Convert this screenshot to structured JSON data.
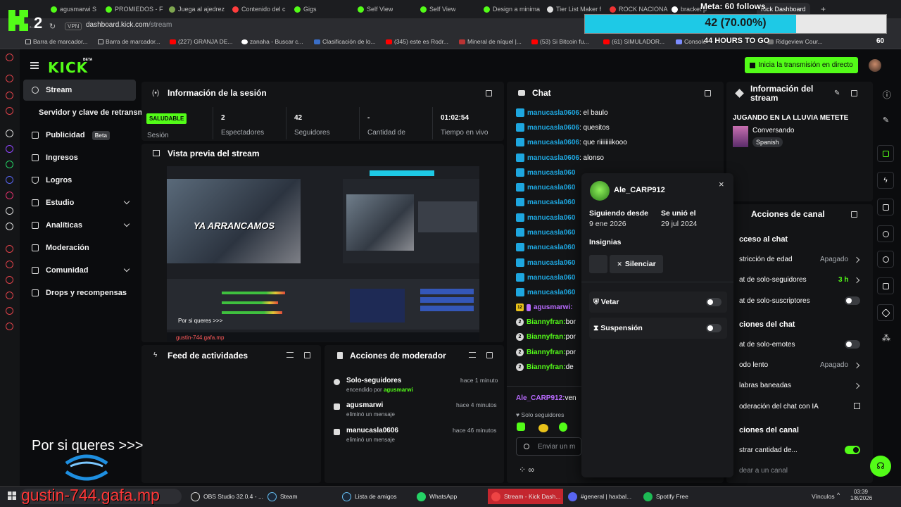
{
  "browser": {
    "tabs": [
      {
        "label": "agusmarwi S"
      },
      {
        "label": "PROMIEDOS - F"
      },
      {
        "label": "Juega al ajedrez"
      },
      {
        "label": "Contenido del c"
      },
      {
        "label": "Gigs"
      },
      {
        "label": "Self View"
      },
      {
        "label": "Self View"
      },
      {
        "label": "Design a minima"
      },
      {
        "label": "Tier List Maker f"
      },
      {
        "label": "ROCK NACIONA"
      },
      {
        "label": "bracket p"
      },
      {
        "label": "Kick Dashboard"
      }
    ],
    "new_tab": "+",
    "vpn": "VPN",
    "url_host": "dashboard.kick.com",
    "url_path": "/stream",
    "bookmarks": [
      "Barra de marcador...",
      "Barra de marcador...",
      "(227) GRANJA DE...",
      "zanaha - Buscar c...",
      "Clasificación de lo...",
      "(345) este es Rodr...",
      "Mineral de níquel |...",
      "(53) Si Bitcoin fu...",
      "(61) SIMULADOR...",
      "Console",
      "Ridgeview Cour..."
    ],
    "bm_count": "60"
  },
  "overlay": {
    "kick_count": "2",
    "meta_title": "Meta: 60 follows",
    "meta_pct_text": "42 (70.00%)",
    "meta_fraction": 0.7,
    "meta_hours": "44 HOURS TO GO",
    "por_si_queres": "Por si queres >>>",
    "gafa_link": "gustin-744.gafa.mp"
  },
  "header": {
    "logo": "KICK",
    "logo_badge": "BETA",
    "go_live": "Inicia la transmisión en directo"
  },
  "sidebar": {
    "items": [
      {
        "label": "Stream"
      },
      {
        "label": "Servidor y clave de retransm"
      },
      {
        "label": "Publicidad",
        "badge": "Beta"
      },
      {
        "label": "Ingresos"
      },
      {
        "label": "Logros"
      },
      {
        "label": "Estudio"
      },
      {
        "label": "Analíticas"
      },
      {
        "label": "Moderación"
      },
      {
        "label": "Comunidad"
      },
      {
        "label": "Drops y recompensas"
      }
    ]
  },
  "session": {
    "title": "Información de la sesión",
    "status": "SALUDABLE",
    "status_label": "Sesión",
    "stats": [
      {
        "value": "2",
        "label": "Espectadores"
      },
      {
        "value": "42",
        "label": "Seguidores"
      },
      {
        "value": "-",
        "label": "Cantidad de"
      },
      {
        "value": "01:02:54",
        "label": "Tiempo en vivo"
      }
    ]
  },
  "preview": {
    "title": "Vista previa del stream",
    "overlay_text": "YA ARRANCAMOS",
    "small_porsi": "Por si queres >>>",
    "small_gafa": "gustin-744.gafa.mp"
  },
  "feed": {
    "title": "Feed de actividades"
  },
  "moderator": {
    "title": "Acciones de moderador",
    "rows": [
      {
        "title": "Solo-seguidores",
        "sub": "encendido por ",
        "sub_user": "agusmarwi",
        "time": "hace 1 minuto"
      },
      {
        "title": "agusmarwi",
        "sub": "eliminó un mensaje",
        "sub_user": "",
        "time": "hace 4 minutos"
      },
      {
        "title": "manucasla0606",
        "sub": "eliminó un mensaje",
        "sub_user": "",
        "time": "hace 46 minutos"
      }
    ]
  },
  "chat": {
    "title": "Chat",
    "lines": [
      {
        "user": "manucasla0606",
        "msg": ": el baulo"
      },
      {
        "user": "manucasla0606",
        "msg": ": quesitos"
      },
      {
        "user": "manucasla0606",
        "msg": ": que riiiiiiiikooo"
      },
      {
        "user": "manucasla0606",
        "msg": ": alonso"
      },
      {
        "user": "manucasla060",
        "msg": ""
      },
      {
        "user": "manucasla060",
        "msg": ""
      },
      {
        "user": "manucasla060",
        "msg": ""
      },
      {
        "user": "manucasla060",
        "msg": ""
      },
      {
        "user": "manucasla060",
        "msg": ""
      },
      {
        "user": "manucasla060",
        "msg": ""
      },
      {
        "user": "manucasla060",
        "msg": ""
      },
      {
        "user": "manucasla060",
        "msg": ""
      },
      {
        "user": "manucasla060",
        "msg": ""
      }
    ],
    "sub_line": {
      "badge": "12",
      "user": "agusmarwi:",
      "msg": ""
    },
    "bianny": [
      {
        "badge": "2",
        "user": "Biannyfran:",
        "msg": " bor"
      },
      {
        "badge": "2",
        "user": "Biannyfran:",
        "msg": " por"
      },
      {
        "badge": "2",
        "user": "Biannyfran:",
        "msg": " por"
      },
      {
        "badge": "2",
        "user": "Biannyfran:",
        "msg": " de"
      }
    ],
    "reply_user": "Ale_CARP912:",
    "reply_msg": " ven",
    "followers_only": "Solo seguidores",
    "input_placeholder": "Enviar un m"
  },
  "usercard": {
    "username": "Ale_CARP912",
    "following_since_label": "Siguiendo desde",
    "following_since": "9 ene 2026",
    "joined_label": "Se unió el",
    "joined": "29 jul 2024",
    "badges_label": "Insignias",
    "silence": "Silenciar",
    "ban": "Vetar",
    "timeout": "Suspensión"
  },
  "stream_info": {
    "title": "Información del stream",
    "stream_title": "JUGANDO EN LA LLUVIA METETE",
    "category": "Conversando",
    "language": "Spanish"
  },
  "channel_actions": {
    "title": "Acciones de canal",
    "section_chat_access": "cceso al chat",
    "rows_access": [
      {
        "label": "stricción de edad",
        "value": "Apagado"
      },
      {
        "label": "at de solo-seguidores",
        "value": "3 h"
      },
      {
        "label": "at de solo-suscriptores",
        "value": ""
      }
    ],
    "section_chat_options": "ciones del chat",
    "rows_options": [
      {
        "label": "at de solo-emotes",
        "value": ""
      },
      {
        "label": "odo lento",
        "value": "Apagado"
      },
      {
        "label": "labras baneadas",
        "value": ""
      },
      {
        "label": "oderación del chat con IA",
        "value": ""
      }
    ],
    "section_channel": "ciones del canal",
    "rows_channel": [
      {
        "label": "strar cantidad de...",
        "value": ""
      },
      {
        "label": "dear a un canal",
        "value": ""
      }
    ]
  },
  "taskbar": {
    "search": "gustin-744.gafa.mp",
    "items": [
      {
        "label": "OBS Studio 32.0.4 - ..."
      },
      {
        "label": "Steam"
      },
      {
        "label": "Lista de amigos"
      },
      {
        "label": "WhatsApp"
      },
      {
        "label": "Stream - Kick Dash..."
      },
      {
        "label": "#general | haxbal..."
      },
      {
        "label": "Spotify Free"
      }
    ],
    "links": "Vínculos",
    "time": "03:39",
    "date": "1/8/2026"
  }
}
